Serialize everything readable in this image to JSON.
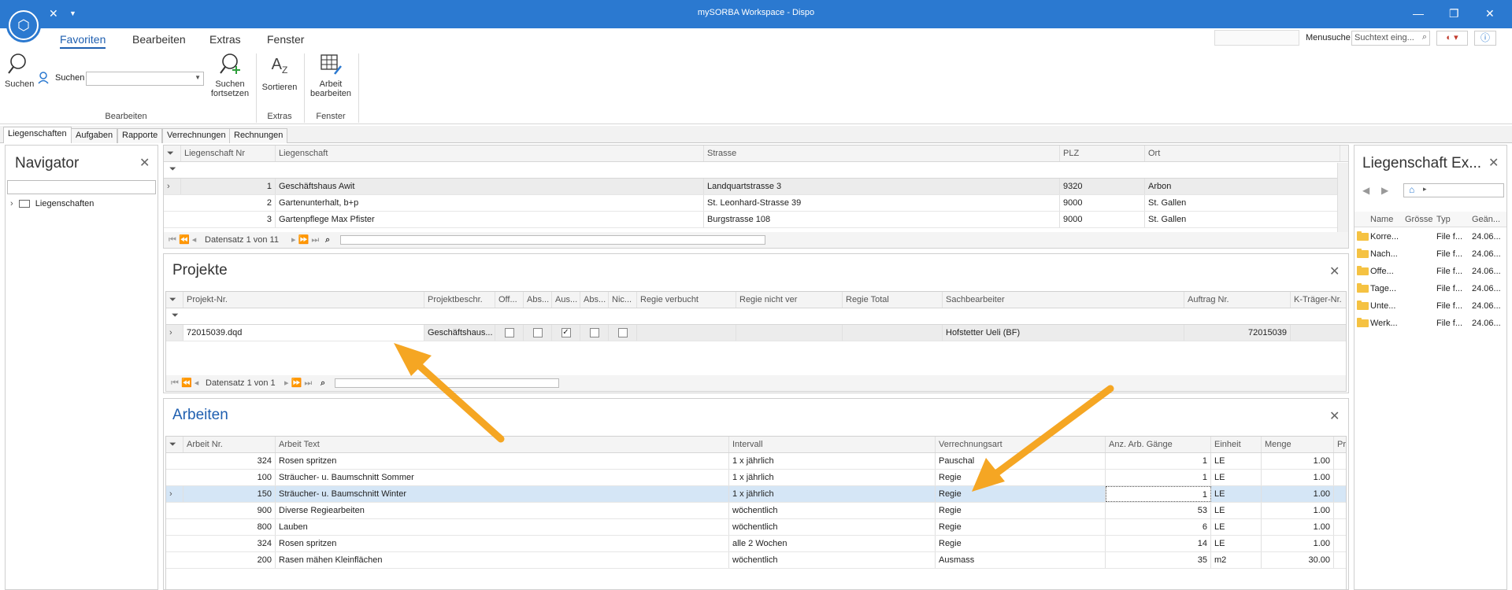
{
  "window": {
    "title": "mySORBA Workspace - Dispo"
  },
  "menu": {
    "items": [
      "Favoriten",
      "Bearbeiten",
      "Extras",
      "Fenster"
    ],
    "search_label": "Menusuche",
    "search_placeholder": "Suchtext eing..."
  },
  "ribbon": {
    "suchen": "Suchen",
    "suchen_field_label": "Suchen",
    "suchen_fortsetzen_1": "Suchen",
    "suchen_fortsetzen_2": "fortsetzen",
    "sortieren": "Sortieren",
    "arbeit_1": "Arbeit",
    "arbeit_2": "bearbeiten",
    "group_bearbeiten": "Bearbeiten",
    "group_extras": "Extras",
    "group_fenster": "Fenster"
  },
  "doc_tabs": [
    "Liegenschaften",
    "Aufgaben",
    "Rapporte",
    "Verrechnungen",
    "Rechnungen"
  ],
  "navigator": {
    "title": "Navigator",
    "tree_root": "Liegenschaften"
  },
  "liegenschaften": {
    "columns": [
      "Liegenschaft Nr",
      "Liegenschaft",
      "Strasse",
      "PLZ",
      "Ort"
    ],
    "rows": [
      [
        "1",
        "Geschäftshaus Awit",
        "Landquartstrasse 3",
        "9320",
        "Arbon"
      ],
      [
        "2",
        "Gartenunterhalt, b+p",
        "St. Leonhard-Strasse 39",
        "9000",
        "St. Gallen"
      ],
      [
        "3",
        "Gartenpflege Max Pfister",
        "Burgstrasse 108",
        "9000",
        "St. Gallen"
      ]
    ],
    "pager": "Datensatz 1 von 11"
  },
  "projekte": {
    "title": "Projekte",
    "columns": [
      "Projekt-Nr.",
      "Projektbeschr.",
      "Off...",
      "Abs...",
      "Aus...",
      "Abs...",
      "Nic...",
      "Regie verbucht",
      "Regie nicht ver",
      "Regie Total",
      "Sachbearbeiter",
      "Auftrag Nr.",
      "K-Träger-Nr."
    ],
    "row": {
      "projekt_nr": "72015039.dqd",
      "beschr": "Geschäftshaus...",
      "checks": [
        false,
        false,
        true,
        false,
        false
      ],
      "sachbearbeiter": "Hofstetter Ueli (BF)",
      "auftrag": "72015039"
    },
    "pager": "Datensatz 1 von 1"
  },
  "arbeiten": {
    "title": "Arbeiten",
    "columns": [
      "Arbeit Nr.",
      "Arbeit Text",
      "Intervall",
      "Verrechnungsart",
      "Anz. Arb. Gänge",
      "Einheit",
      "Menge",
      "Pre"
    ],
    "rows": [
      [
        "324",
        "Rosen spritzen",
        "1 x jährlich",
        "Pauschal",
        "1",
        "LE",
        "1.00"
      ],
      [
        "100",
        "Sträucher- u. Baumschnitt Sommer",
        "1 x jährlich",
        "Regie",
        "1",
        "LE",
        "1.00"
      ],
      [
        "150",
        "Sträucher- u. Baumschnitt Winter",
        "1 x jährlich",
        "Regie",
        "1",
        "LE",
        "1.00"
      ],
      [
        "900",
        "Diverse Regiearbeiten",
        "wöchentlich",
        "Regie",
        "53",
        "LE",
        "1.00"
      ],
      [
        "800",
        "Lauben",
        "wöchentlich",
        "Regie",
        "6",
        "LE",
        "1.00"
      ],
      [
        "324",
        "Rosen spritzen",
        "alle 2 Wochen",
        "Regie",
        "14",
        "LE",
        "1.00"
      ],
      [
        "200",
        "Rasen mähen Kleinflächen",
        "wöchentlich",
        "Ausmass",
        "35",
        "m2",
        "30.00"
      ]
    ]
  },
  "explorer": {
    "title": "Liegenschaft Ex...",
    "columns": [
      "Name",
      "Grösse",
      "Typ",
      "Geän..."
    ],
    "rows": [
      [
        "Korre...",
        "File f...",
        "24.06..."
      ],
      [
        "Nach...",
        "File f...",
        "24.06..."
      ],
      [
        "Offe...",
        "File f...",
        "24.06..."
      ],
      [
        "Tage...",
        "File f...",
        "24.06..."
      ],
      [
        "Unte...",
        "File f...",
        "24.06..."
      ],
      [
        "Werk...",
        "File f...",
        "24.06..."
      ]
    ]
  },
  "colors": {
    "accent": "#2b79d0",
    "selected_row": "#d5e6f6",
    "arrow": "#f5a623"
  }
}
